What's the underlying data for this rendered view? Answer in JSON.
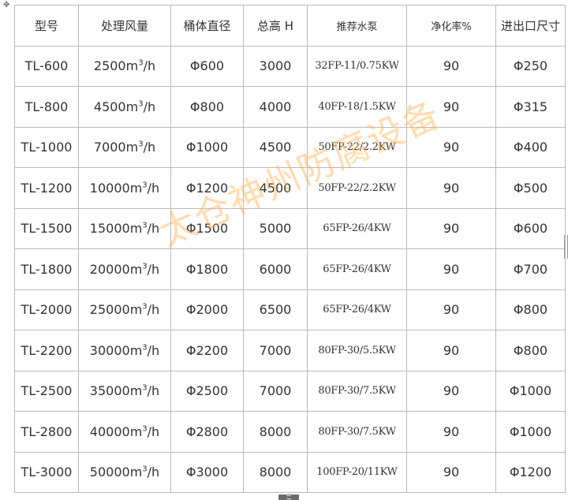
{
  "headers": [
    "型号",
    "处理风量",
    "桶体直径",
    "总高 H",
    "推荐水泵",
    "净化率%",
    "进出口尺寸"
  ],
  "unit_sup": "3",
  "unit_suffix": "/h",
  "rows": [
    {
      "model": "TL-600",
      "flow_num": "2500m",
      "diameter": "Φ600",
      "height": "3000",
      "pump": "32FP-11/0.75KW",
      "rate": "90",
      "port": "Φ250"
    },
    {
      "model": "TL-800",
      "flow_num": "4500m",
      "diameter": "Φ800",
      "height": "4000",
      "pump": "40FP-18/1.5KW",
      "rate": "90",
      "port": "Φ315"
    },
    {
      "model": "TL-1000",
      "flow_num": "7000m",
      "diameter": "Φ1000",
      "height": "4500",
      "pump": "50FP-22/2.2KW",
      "rate": "90",
      "port": "Φ400"
    },
    {
      "model": "TL-1200",
      "flow_num": "10000m",
      "diameter": "Φ1200",
      "height": "4500",
      "pump": "50FP-22/2.2KW",
      "rate": "90",
      "port": "Φ500"
    },
    {
      "model": "TL-1500",
      "flow_num": "15000m",
      "diameter": "Φ1500",
      "height": "5000",
      "pump": "65FP-26/4KW",
      "rate": "90",
      "port": "Φ600"
    },
    {
      "model": "TL-1800",
      "flow_num": "20000m",
      "diameter": "Φ1800",
      "height": "6000",
      "pump": "65FP-26/4KW",
      "rate": "90",
      "port": "Φ700"
    },
    {
      "model": "TL-2000",
      "flow_num": "25000m",
      "diameter": "Φ2000",
      "height": "6500",
      "pump": "65FP-26/4KW",
      "rate": "90",
      "port": "Φ800"
    },
    {
      "model": "TL-2200",
      "flow_num": "30000m",
      "diameter": "Φ2200",
      "height": "7000",
      "pump": "80FP-30/5.5KW",
      "rate": "90",
      "port": "Φ800"
    },
    {
      "model": "TL-2500",
      "flow_num": "35000m",
      "diameter": "Φ2500",
      "height": "7000",
      "pump": "80FP-30/7.5KW",
      "rate": "90",
      "port": "Φ1000"
    },
    {
      "model": "TL-2800",
      "flow_num": "40000m",
      "diameter": "Φ2800",
      "height": "8000",
      "pump": "80FP-30/7.5KW",
      "rate": "90",
      "port": "Φ1000"
    },
    {
      "model": "TL-3000",
      "flow_num": "50000m",
      "diameter": "Φ3000",
      "height": "8000",
      "pump": "100FP-20/11KW",
      "rate": "90",
      "port": "Φ1200"
    }
  ],
  "watermark": "太仓神州防腐设备",
  "icons": {
    "corner": "move-handle-icon",
    "scroll": "scroll-handle-icon"
  }
}
